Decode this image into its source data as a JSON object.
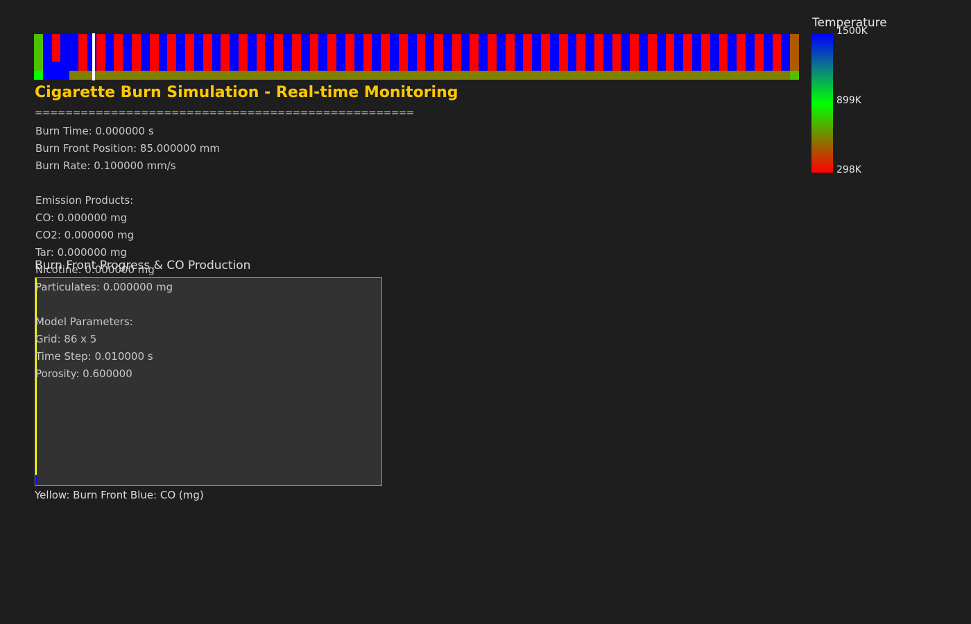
{
  "grid": {
    "cols": 86,
    "rows": 5,
    "burn_front_column": 6,
    "colors": {
      "blue": "#0000ff",
      "red": "#ff0000",
      "olive": "#7f7f00",
      "green": "#00ff00",
      "ember": "#ae5a00",
      "lime": "#4fbf00"
    }
  },
  "title": "Cigarette Burn Simulation - Real-time Monitoring",
  "divider": "==================================================",
  "stats": [
    "Burn Time: 0.000000 s",
    "Burn Front Position: 85.000000 mm",
    "Burn Rate: 0.100000 mm/s",
    "",
    "Emission Products:",
    "CO: 0.000000 mg",
    "CO2: 0.000000 mg",
    "Tar: 0.000000 mg",
    "Nicotine: 0.000000 mg",
    "Particulates: 0.000000 mg",
    "",
    "Model Parameters:",
    "Grid: 86 x 5",
    "Time Step: 0.010000 s",
    "Porosity: 0.600000"
  ],
  "legend": {
    "title": "Temperature",
    "max_label": "1500K",
    "mid_label": "899K",
    "min_label": "298K",
    "gradient": [
      "#0000ff",
      "#0c7f86",
      "#00ff00",
      "#7f7f00",
      "#ff0000"
    ]
  },
  "plot": {
    "title": "Burn Front Progress & CO Production",
    "caption": "Yellow: Burn Front  Blue: CO (mg)",
    "colors": {
      "burn_front": "#ffff00",
      "co": "#0000ff",
      "background": "#323232",
      "border": "#969696"
    }
  }
}
